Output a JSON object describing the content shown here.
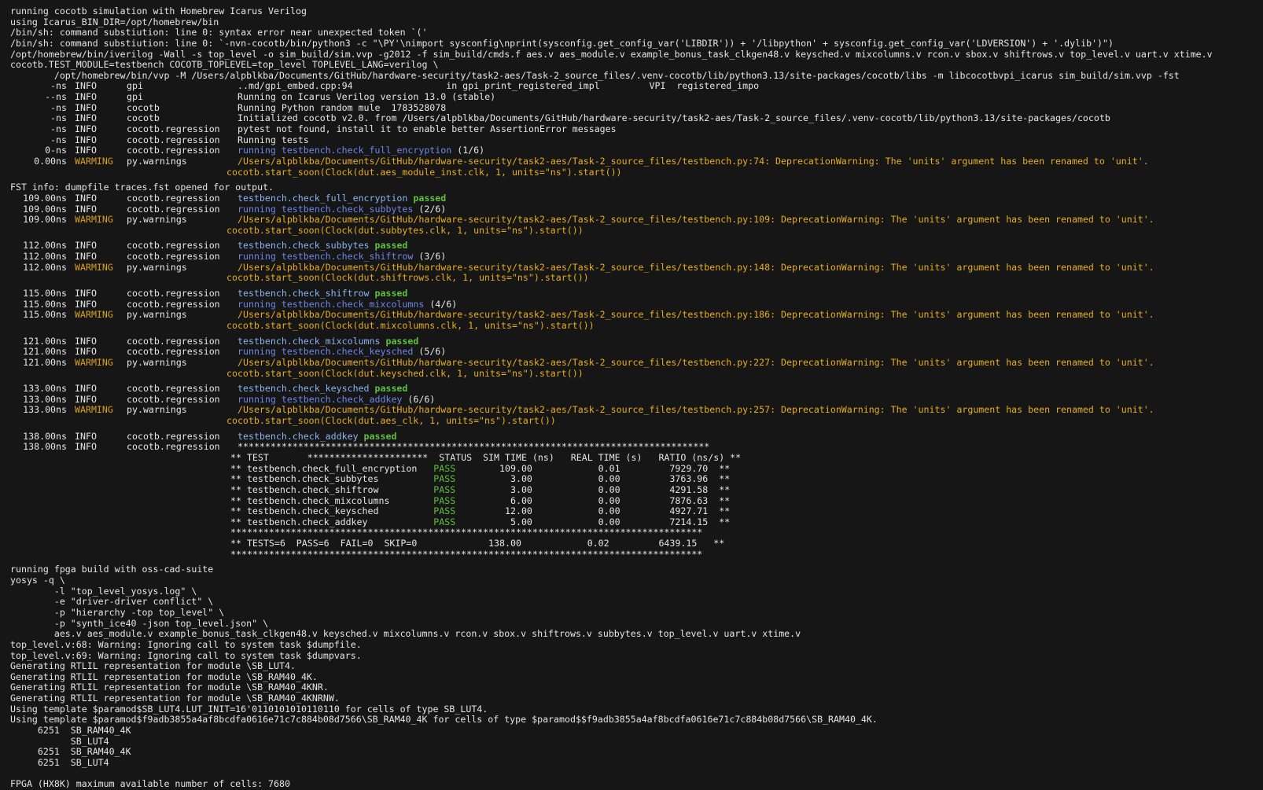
{
  "colors": {
    "background": "#161616",
    "text": "#e6e6e6",
    "warning": "#e8ae1a",
    "running": "#6f86e6",
    "passed": "#5ec13b"
  },
  "header_lines": [
    "running cocotb simulation with Homebrew Icarus Verilog",
    "using Icarus_BIN_DIR=/opt/homebrew/bin",
    "/bin/sh: command substiution: line 0: syntax error near unexpected token `('",
    "/bin/sh: command substiution: line 0: `-nvn-cocotb/bin/python3 -c \"\\PY'\\nimport sysconfig\\nprint(sysconfig.get_config_var('LIBDIR')) + '/libpython' + sysconfig.get_config_var('LDVERSION') + '.dylib')\")",
    "/opt/homebrew/bin/iverilog -Wall -s top_level -o sim_build/sim.vvp -g2012 -f sim_build/cmds.f aes.v aes_module.v example_bonus_task_clkgen48.v keysched.v mixcolumns.v rcon.v sbox.v shiftrows.v top_level.v uart.v xtime.v",
    "cocotb.TEST_MODULE=testbench COCOTB_TOPLEVEL=top_level TOPLEVEL_LANG=verilog \\",
    "        /opt/homebrew/bin/vvp -M /Users/alpblkba/Documents/GitHub/hardware-security/task2-aes/Task-2_source_files/.venv-cocotb/lib/python3.13/site-packages/cocotb/libs -m libcocotbvpi_icarus sim_build/sim.vvp -fst"
  ],
  "log_top": [
    {
      "ts": "-ns",
      "lvl": "INFO",
      "logger": "gpi",
      "msg": "..md/gpi_embed.cpp:94                 in gpi_print_registered_impl         VPI  registered_impo"
    },
    {
      "ts": "--ns",
      "lvl": "INFO",
      "logger": "gpi",
      "msg": "Running on Icarus Verilog version 13.0 (stable)"
    },
    {
      "ts": "-ns",
      "lvl": "INFO",
      "logger": "cocotb",
      "msg": "Running Python random mule  1783528078"
    },
    {
      "ts": "-ns",
      "lvl": "INFO",
      "logger": "cocotb",
      "msg": "Initialized cocotb v2.0. from /Users/alpblkba/Documents/GitHub/hardware-security/task2-aes/Task-2_source_files/.venv-cocotb/lib/python3.13/site-packages/cocotb"
    },
    {
      "ts": "-ns",
      "lvl": "INFO",
      "logger": "cocotb.regression",
      "msg": "pytest not found, install it to enable better AssertionError messages"
    },
    {
      "ts": "-ns",
      "lvl": "INFO",
      "logger": "cocotb.regression",
      "msg": "Running tests"
    }
  ],
  "tests": [
    {
      "run_ts": "0-ns",
      "run_name": "testbench.check_full_encryption",
      "run_idx": "(1/6)",
      "warn_ts": "0.00ns",
      "warn_path": "/Users/alpblkba/Documents/GitHub/hardware-security/task2-aes/Task-2_source_files/testbench.py:74: DeprecationWarning: The 'units' argument has been renamed to 'unit'.",
      "warn_code": " cocotb.start_soon(Clock(dut.aes_module_inst.clk, 1, units=\"ns\").start())"
    },
    {
      "pass_ts": "109.00ns",
      "pass_name": "testbench.check_full_encryption",
      "run_ts": "109.00ns",
      "run_name": "testbench.check_subbytes",
      "run_idx": "(2/6)",
      "warn_ts": "109.00ns",
      "warn_path": "/Users/alpblkba/Documents/GitHub/hardware-security/task2-aes/Task-2_source_files/testbench.py:109: DeprecationWarning: The 'units' argument has been renamed to 'unit'.",
      "warn_code": " cocotb.start_soon(Clock(dut.subbytes.clk, 1, units=\"ns\").start())"
    },
    {
      "pass_ts": "112.00ns",
      "pass_name": "testbench.check_subbytes",
      "run_ts": "112.00ns",
      "run_name": "testbench.check_shiftrow",
      "run_idx": "(3/6)",
      "warn_ts": "112.00ns",
      "warn_path": "/Users/alpblkba/Documents/GitHub/hardware-security/task2-aes/Task-2_source_files/testbench.py:148: DeprecationWarning: The 'units' argument has been renamed to 'unit'.",
      "warn_code": " cocotb.start_soon(Clock(dut.shiftrows.clk, 1, units=\"ns\").start())"
    },
    {
      "pass_ts": "115.00ns",
      "pass_name": "testbench.check_shiftrow",
      "run_ts": "115.00ns",
      "run_name": "testbench.check_mixcolumns",
      "run_idx": "(4/6)",
      "warn_ts": "115.00ns",
      "warn_path": "/Users/alpblkba/Documents/GitHub/hardware-security/task2-aes/Task-2_source_files/testbench.py:186: DeprecationWarning: The 'units' argument has been renamed to 'unit'.",
      "warn_code": " cocotb.start_soon(Clock(dut.mixcolumns.clk, 1, units=\"ns\").start())"
    },
    {
      "pass_ts": "121.00ns",
      "pass_name": "testbench.check_mixcolumns",
      "run_ts": "121.00ns",
      "run_name": "testbench.check_keysched",
      "run_idx": "(5/6)",
      "warn_ts": "121.00ns",
      "warn_path": "/Users/alpblkba/Documents/GitHub/hardware-security/task2-aes/Task-2_source_files/testbench.py:227: DeprecationWarning: The 'units' argument has been renamed to 'unit'.",
      "warn_code": " cocotb.start_soon(Clock(dut.keysched.clk, 1, units=\"ns\").start())"
    },
    {
      "pass_ts": "133.00ns",
      "pass_name": "testbench.check_keysched",
      "run_ts": "133.00ns",
      "run_name": "testbench.check_addkey",
      "run_idx": "(6/6)",
      "warn_ts": "133.00ns",
      "warn_path": "/Users/alpblkba/Documents/GitHub/hardware-security/task2-aes/Task-2_source_files/testbench.py:257: DeprecationWarning: The 'units' argument has been renamed to 'unit'.",
      "warn_code": " cocotb.start_soon(Clock(dut.aes_clk, 1, units=\"ns\").start())"
    }
  ],
  "fst_info": "FST info: dumpfile traces.fst opened for output.",
  "final": {
    "pass_ts": "138.00ns",
    "pass_name": "testbench.check_addkey",
    "summary_ts": "138.00ns"
  },
  "labels": {
    "info": "INFO",
    "warning": "WARMING",
    "warning_first": "WARMING",
    "regression": "cocotb.regression",
    "pywarnings": "py.warnings",
    "running": "running",
    "passed": "passed"
  },
  "summary": {
    "stars": "**************************************************************************************",
    "header": "** TEST       **********************  STATUS  SIM TIME (ns)   REAL TIME (s)   RATIO (ns/s) **",
    "rows": [
      "** testbench.check_full_encryption   PASS        109.00            0.01         7929.70  **",
      "** testbench.check_subbytes          PASS          3.00            0.00         3763.96  **",
      "** testbench.check_shiftrow          PASS          3.00            0.00         4291.58  **",
      "** testbench.check_mixcolumns        PASS          6.00            0.00         7876.63  **",
      "** testbench.check_keysched          PASS         12.00            0.00         4927.71  **",
      "** testbench.check_addkey            PASS          5.00            0.00         7214.15  **"
    ],
    "total": "** TESTS=6  PASS=6  FAIL=0  SKIP=0             138.00            0.02         6439.15   **"
  },
  "fpga_lines": [
    "running fpga build with oss-cad-suite",
    "yosys -q \\",
    "        -l \"top_level_yosys.log\" \\",
    "        -e \"driver-driver conflict\" \\",
    "        -p \"hierarchy -top top_level\" \\",
    "        -p \"synth_ice40 -json top_level.json\" \\",
    "        aes.v aes_module.v example_bonus_task_clkgen48.v keysched.v mixcolumns.v rcon.v sbox.v shiftrows.v subbytes.v top_level.v uart.v xtime.v",
    "top_level.v:68: Warning: Ignoring call to system task $dumpfile.",
    "top_level.v:69: Warning: Ignoring call to system task $dumpvars.",
    "Generating RTLIL representation for module \\SB_LUT4.",
    "Generating RTLIL representation for module \\SB_RAM40_4K.",
    "Generating RTLIL representation for module \\SB_RAM40_4KNR.",
    "Generating RTLIL representation for module \\SB_RAM40_4KNRNW.",
    "Using template $paramod$SB_LUT4.LUT_INIT=16'0110101010110110 for cells of type SB_LUT4.",
    "Using template $paramod$f9adb3855a4af8bcdfa0616e71c7c884b08d7566\\SB_RAM40_4K for cells of type $paramod$$f9adb3855a4af8bcdfa0616e71c7c884b08d7566\\SB_RAM40_4K.",
    "     6251  SB_RAM40_4K",
    "           SB_LUT4",
    "     6251  SB_RAM40_4K",
    "     6251  SB_LUT4"
  ],
  "fpga_max": "FPGA (HX8K) maximum available number of cells: 7680"
}
